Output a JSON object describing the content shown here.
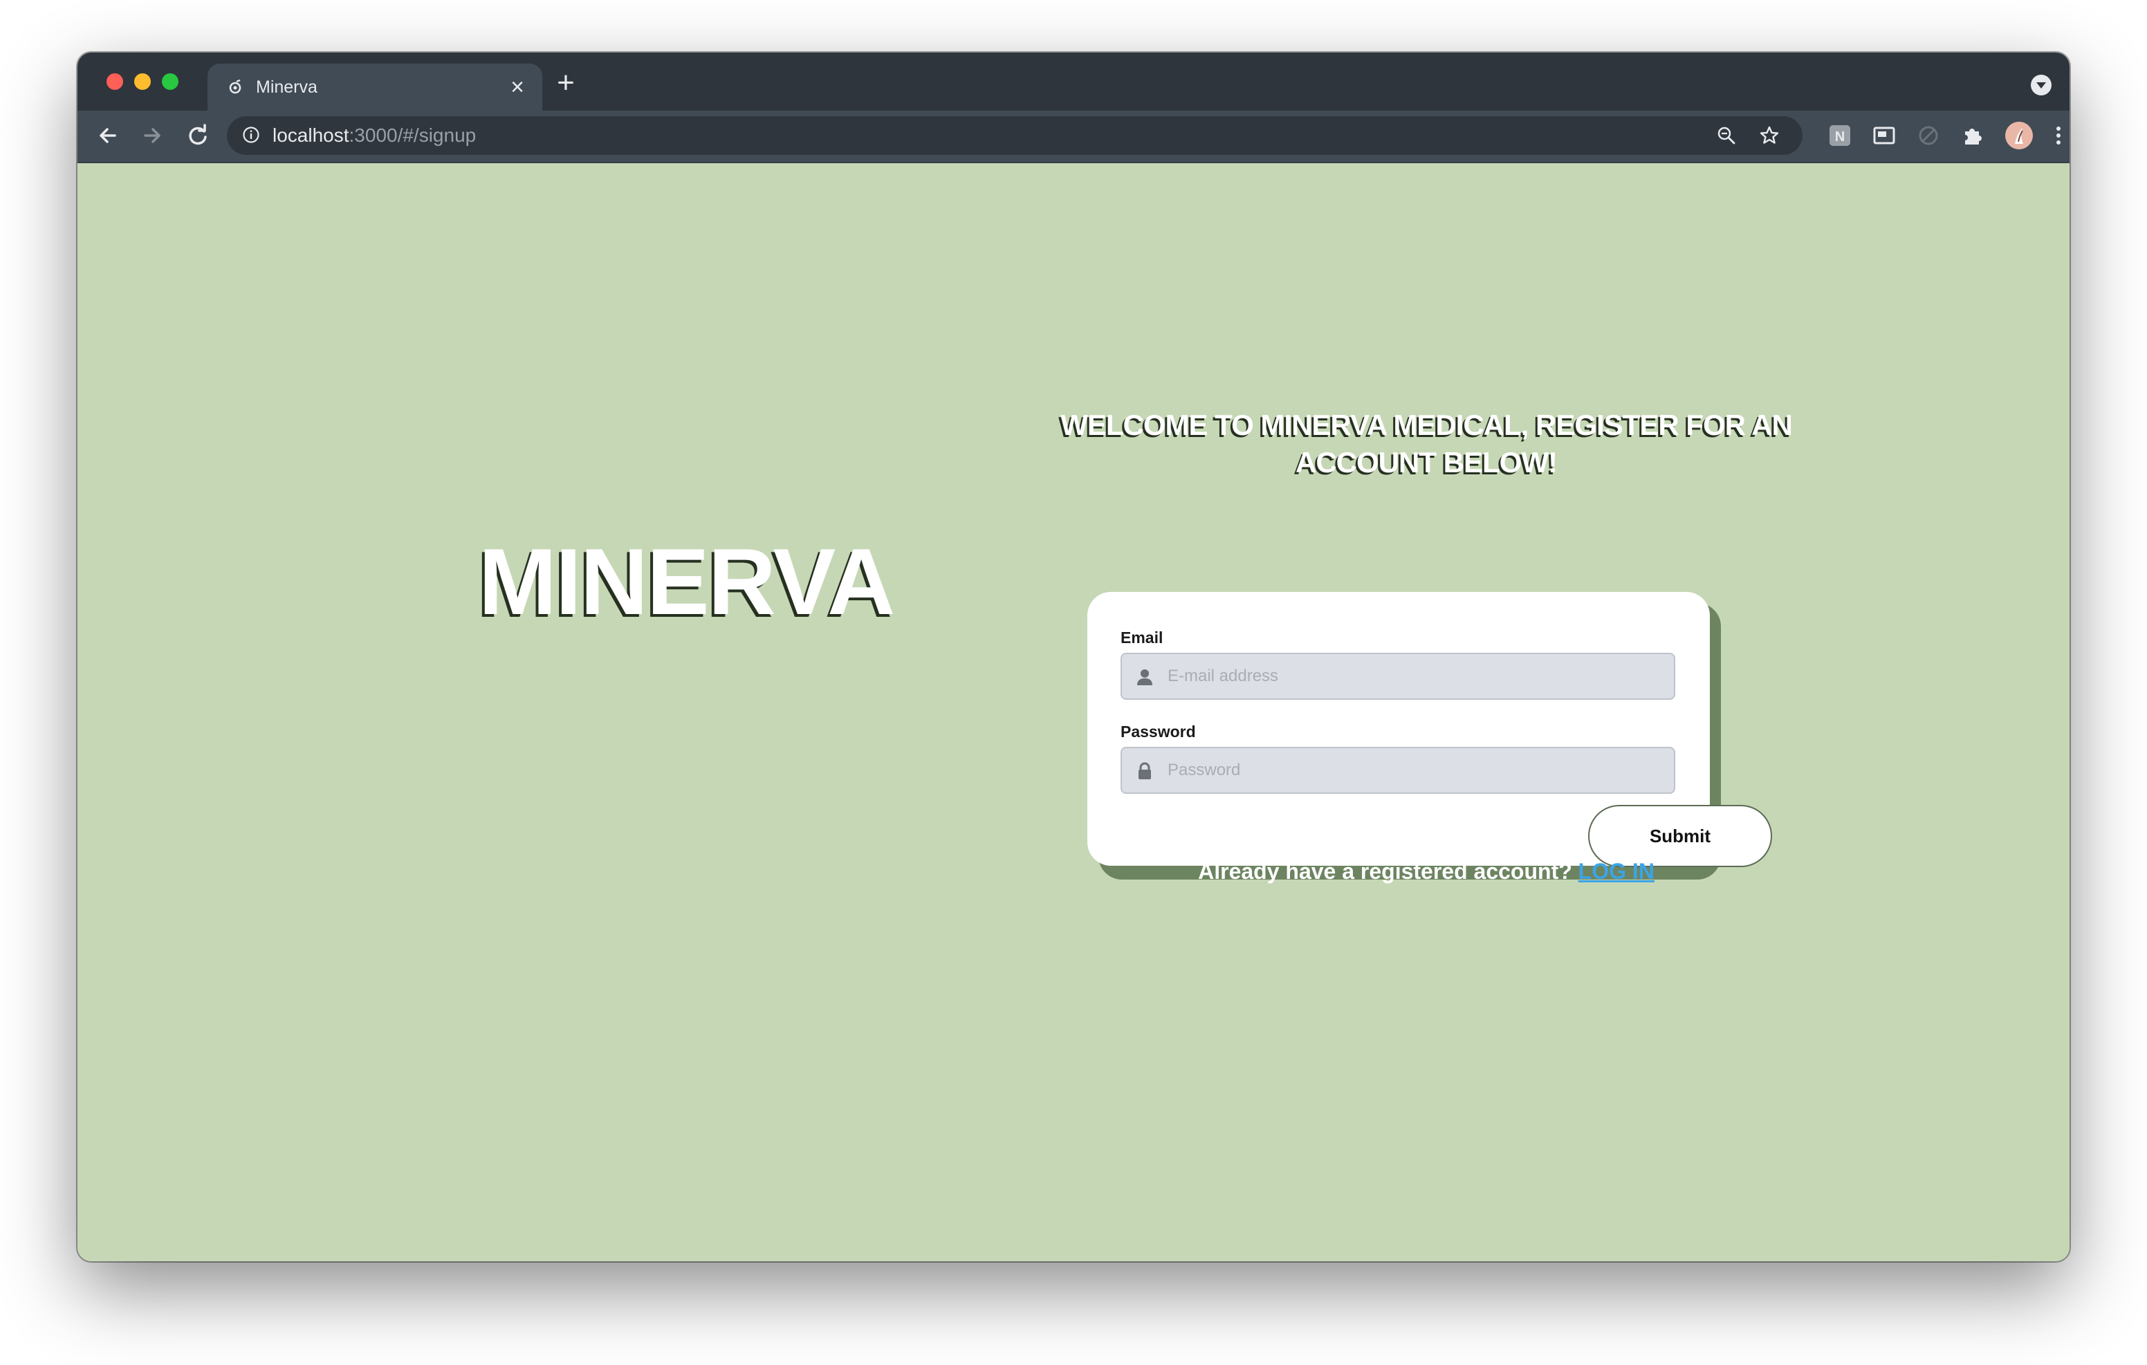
{
  "browser": {
    "tab": {
      "title": "Minerva",
      "favicon": "minerva-favicon-icon"
    },
    "url": {
      "host": "localhost",
      "path": ":3000/#/signup"
    },
    "toolbar_icons": [
      "back-arrow-icon",
      "forward-arrow-icon",
      "reload-icon",
      "site-info-icon",
      "zoom-icon",
      "bookmark-star-icon",
      "extension-n-icon",
      "picture-in-picture-icon",
      "extension-icon",
      "puzzle-extensions-icon",
      "profile-avatar",
      "menu-kebab-icon"
    ]
  },
  "page": {
    "logo": "MINERVA",
    "welcome": "WELCOME TO MINERVA MEDICAL, REGISTER FOR AN ACCOUNT BELOW!",
    "form": {
      "email_label": "Email",
      "email_placeholder": "E-mail address",
      "password_label": "Password",
      "password_placeholder": "Password",
      "submit_label": "Submit"
    },
    "login_prompt": "Already have a registered account?",
    "login_link": "LOG IN"
  },
  "colors": {
    "page_background": "#c6d7b5",
    "card_shadow": "#6d8461",
    "link": "#3ba4e6"
  }
}
